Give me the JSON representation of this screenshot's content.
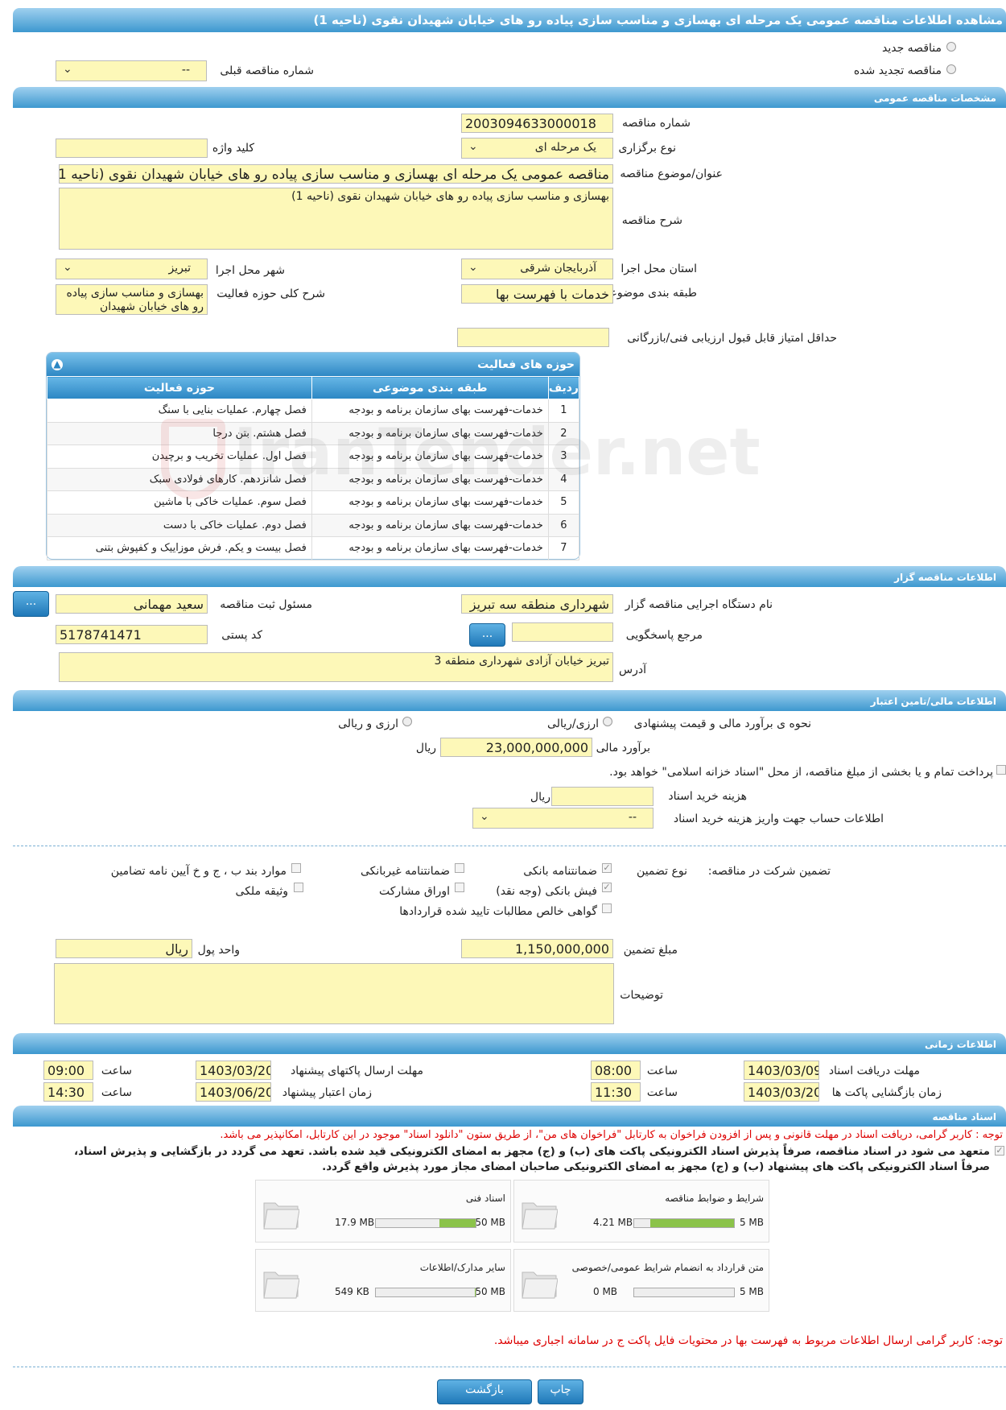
{
  "title": "مشاهده اطلاعات مناقصه عمومی یک مرحله ای بهسازی و مناسب سازی پیاده رو های خیابان شهیدان نقوی (ناحیه 1)",
  "header": {
    "new_tender": "مناقصه جدید",
    "renewed_tender": "مناقصه تجدید شده",
    "prev_number_label": "شماره مناقصه قبلی",
    "prev_number_value": "--"
  },
  "general": {
    "section": "مشخصات مناقصه عمومی",
    "number_label": "شماره مناقصه",
    "number_value": "2003094633000018",
    "type_label": "نوع برگزاری",
    "type_value": "یک مرحله ای",
    "keyword_label": "کلید واژه",
    "keyword_value": "",
    "subject_label": "عنوان/موضوع مناقصه",
    "subject_value": "مناقصه عمومی یک مرحله ای بهسازی و مناسب سازی پیاده رو های خیابان شهیدان نقوی (ناحیه 1)",
    "desc_label": "شرح مناقصه",
    "desc_value": "بهسازی و مناسب سازی پیاده رو های خیابان شهیدان نقوی (ناحیه 1)",
    "province_label": "استان محل اجرا",
    "province_value": "آذربایجان شرقی",
    "city_label": "شهر محل اجرا",
    "city_value": "تبریز",
    "category_label": "طبقه بندی موضوعی",
    "category_value": "خدمات با فهرست بها",
    "scope_label": "شرح کلی حوزه فعالیت",
    "scope_value": "بهسازی و مناسب سازی پیاده رو های خیابان شهیدان",
    "min_score_label": "حداقل امتیاز قابل قبول ارزیابی فنی/بازرگانی",
    "min_score_value": ""
  },
  "activities": {
    "title": "حوزه های فعالیت",
    "headers": [
      "ردیف",
      "طبقه بندی موضوعی",
      "حوزه فعالیت"
    ],
    "rows": [
      [
        "1",
        "خدمات-فهرست بهای سازمان برنامه و بودجه",
        "فصل چهارم. عملیات بنایی با سنگ"
      ],
      [
        "2",
        "خدمات-فهرست بهای سازمان برنامه و بودجه",
        "فصل هشتم. بتن درجا"
      ],
      [
        "3",
        "خدمات-فهرست بهای سازمان برنامه و بودجه",
        "فصل اول. عملیات تخریب و برچیدن"
      ],
      [
        "4",
        "خدمات-فهرست بهای سازمان برنامه و بودجه",
        "فصل شانزدهم. کارهای فولادی سبک"
      ],
      [
        "5",
        "خدمات-فهرست بهای سازمان برنامه و بودجه",
        "فصل سوم. عملیات خاکی با ماشین"
      ],
      [
        "6",
        "خدمات-فهرست بهای سازمان برنامه و بودجه",
        "فصل دوم. عملیات خاکی با دست"
      ],
      [
        "7",
        "خدمات-فهرست بهای سازمان برنامه و بودجه",
        "فصل بیست و یکم. فرش موزاییک و کفپوش بتنی"
      ]
    ]
  },
  "organizer": {
    "section": "اطلاعات مناقصه گزار",
    "org_label": "نام دستگاه اجرایی مناقصه گزار",
    "org_value": "شهرداری منطقه سه تبریز",
    "resp_label": "مسئول ثبت مناقصه",
    "resp_value": "سعید مهمانی",
    "ref_label": "مرجع پاسخگویی",
    "ref_value": "",
    "postal_label": "کد پستی",
    "postal_value": "5178741471",
    "address_label": "آدرس",
    "address_value": "تبریز خیابان آزادی شهرداری منطقه 3",
    "btn": "..."
  },
  "finance": {
    "section": "اطلاعات مالی/تامین اعتبار",
    "method_label": "نحوه ی برآورد مالی و قیمت پیشنهادی",
    "opt1": "ارزی/ریالی",
    "opt2": "ارزی و ریالی",
    "estimate_label": "برآورد مالی",
    "estimate_value": "23,000,000,000",
    "currency": "ریال",
    "treasury_text": "پرداخت تمام و یا بخشی از مبلغ مناقصه، از محل \"اسناد خزانه اسلامی\" خواهد بود.",
    "doc_cost_label": "هزینه خرید اسناد",
    "doc_cost_value": "",
    "doc_cost_unit": "ریال",
    "account_label": "اطلاعات حساب جهت واریز هزینه خرید اسناد",
    "account_value": "--"
  },
  "guarantee": {
    "label": "تضمین شرکت در مناقصه:",
    "type_label": "نوع تضمین",
    "bank": "ضمانتنامه بانکی",
    "nonbank": "ضمانتنامه غیربانکی",
    "clauses": "موارد بند ب ، ج و خ آیین نامه تضامین",
    "receipt": "فیش بانکی (وجه نقد)",
    "bonds": "اوراق مشارکت",
    "property": "وثیقه ملکی",
    "claims": "گواهی خالص مطالبات تایید شده قراردادها",
    "amount_label": "مبلغ تضمین",
    "amount_value": "1,150,000,000",
    "unit_label": "واحد پول",
    "unit_value": "ریال",
    "notes_label": "توضیحات",
    "notes_value": "",
    "check": "✓"
  },
  "timing": {
    "section": "اطلاعات زمانی",
    "receive_label": "مهلت دریافت اسناد",
    "receive_date": "1403/03/09",
    "receive_time": "08:00",
    "send_label": "مهلت ارسال پاکتهای پیشنهاد",
    "send_date": "1403/03/20",
    "send_time": "09:00",
    "open_label": "زمان بازگشایی پاکت ها",
    "open_date": "1403/03/20",
    "open_time": "11:30",
    "valid_label": "زمان اعتبار پیشنهاد",
    "valid_date": "1403/06/20",
    "valid_time": "14:30",
    "time_label": "ساعت"
  },
  "documents": {
    "section": "اسناد مناقصه",
    "notice": "توجه : کاربر گرامی، دریافت اسناد در مهلت قانونی و پس از افزودن فراخوان به کارتابل \"فراخوان های من\"، از طریق ستون \"دانلود اسناد\" موجود در این کارتابل، امکانپذیر می باشد.",
    "commit1": "متعهد می شود در اسناد مناقصه، صرفاً پذیرش اسناد الکترونیکی پاکت های (ب) و (ج) مجهز به امضای الکترونیکی قید شده باشد. تعهد می گردد در بازگشایی و پذیرش اسناد،",
    "commit2": "صرفاً اسناد الکترونیکی پاکت های پیشنهاد (ب) و (ج) مجهز به امضای الکترونیکی صاحبان امضای مجاز مورد پذیرش واقع گردد.",
    "files": [
      {
        "name": "شرایط و ضوابط مناقصه",
        "size": "4.21 MB",
        "max": "5 MB",
        "pct": 84
      },
      {
        "name": "اسناد فنی",
        "size": "17.9 MB",
        "max": "50 MB",
        "pct": 36
      },
      {
        "name": "متن قرارداد به انضمام شرایط عمومی/خصوصی",
        "size": "0 MB",
        "max": "5 MB",
        "pct": 0
      },
      {
        "name": "سایر مدارک/اطلاعات",
        "size": "549 KB",
        "max": "50 MB",
        "pct": 1
      }
    ],
    "note2": "توجه: کاربر گرامی ارسال اطلاعات مربوط به فهرست بها در محتویات فایل پاکت ج در سامانه اجباری میباشد."
  },
  "buttons": {
    "print": "چاپ",
    "back": "بازگشت"
  },
  "watermark": "IranTender.net",
  "colors": {
    "accent": "#3d98cf",
    "field": "#fdf8b8",
    "note": "#d00000",
    "progress": "#8bc34a"
  }
}
